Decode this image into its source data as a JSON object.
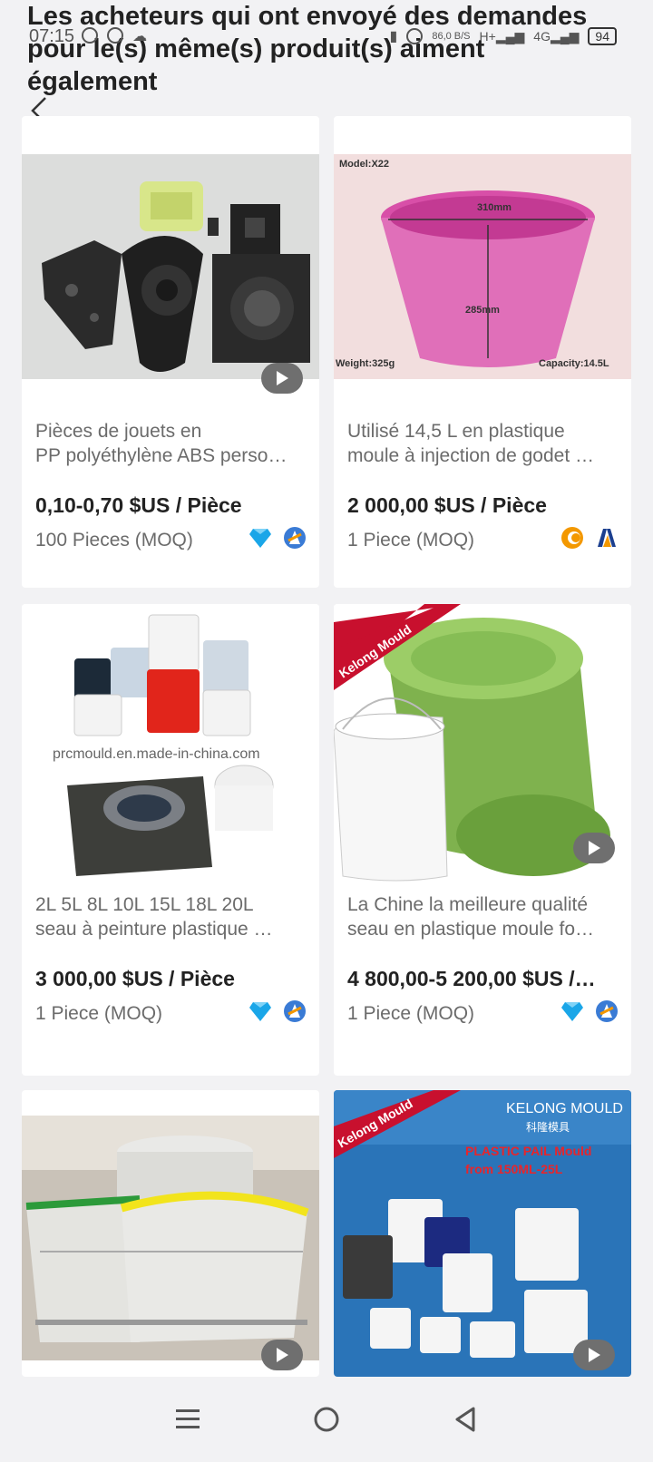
{
  "status_bar": {
    "time": "07:15",
    "speed": "86,0\nB/S",
    "network1": "H+",
    "network2": "4G",
    "battery": "94"
  },
  "header": {
    "title": "Les acheteurs qui ont envoyé des demandes pour le(s) même(s) produit(s) aiment également"
  },
  "products": [
    {
      "title_line1": "Pièces de jouets en",
      "title_line2": "PP polyéthylène ABS perso…",
      "price": "0,10-0,70 $US / Pièce",
      "moq": "100 Pieces (MOQ)",
      "badges": [
        "diamond-icon",
        "verified-icon"
      ],
      "has_video": true
    },
    {
      "title_line1": "Utilisé 14,5 L en plastique",
      "title_line2": "moule à injection de godet …",
      "price": "2 000,00 $US / Pièce",
      "moq": "1 Piece (MOQ)",
      "badges": [
        "gold-supplier-icon",
        "audited-icon"
      ],
      "has_video": false,
      "image_text": {
        "model": "Model:X22",
        "width": "310mm",
        "height": "285mm",
        "weight": "Weight:325g",
        "capacity": "Capacity:14.5L"
      }
    },
    {
      "title_line1": "2L 5L 8L 10L 15L 18L 20L",
      "title_line2": "seau à peinture plastique …",
      "price": "3 000,00 $US / Pièce",
      "moq": "1 Piece (MOQ)",
      "badges": [
        "diamond-icon",
        "verified-icon"
      ],
      "has_video": false,
      "image_text": {
        "watermark": "prcmould.en.made-in-china.com"
      }
    },
    {
      "title_line1": "La Chine la meilleure qualité",
      "title_line2": "seau en plastique moule fo…",
      "price": "4 800,00-5 200,00 $US /…",
      "moq": "1 Piece (MOQ)",
      "badges": [
        "diamond-icon",
        "verified-icon"
      ],
      "has_video": true,
      "image_text": {
        "ribbon": "Kelong Mould"
      }
    },
    {
      "has_video": true
    },
    {
      "has_video": true,
      "image_text": {
        "ribbon": "Kelong Mould",
        "brand": "KELONG MOULD",
        "brand_cn": "科隆模具",
        "line1": "PLASTIC PAIL Mould",
        "line2": "from 150ML-25L"
      }
    }
  ],
  "colors": {
    "background": "#f2f2f4",
    "card": "#ffffff",
    "diamond": "#1aa6e8",
    "verified": "#3a7bd5",
    "gold": "#f39800"
  }
}
